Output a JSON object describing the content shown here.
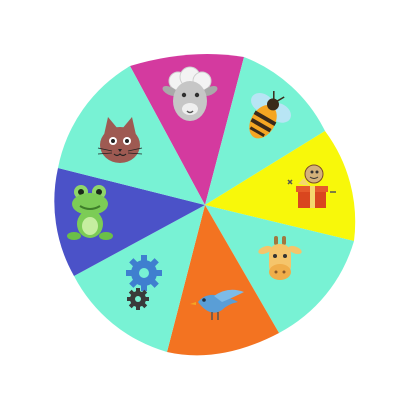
{
  "wheel": {
    "segments": [
      {
        "id": "sheep",
        "color": "#d43a9f",
        "icon": "sheep-icon"
      },
      {
        "id": "bee",
        "color": "#78f2d4",
        "icon": "bee-icon"
      },
      {
        "id": "gift",
        "color": "#f8f80a",
        "icon": "gift-icon"
      },
      {
        "id": "cow",
        "color": "#78f2d4",
        "icon": "cow-icon"
      },
      {
        "id": "bird",
        "color": "#f37321",
        "icon": "bird-icon"
      },
      {
        "id": "settings",
        "color": "#78f2d4",
        "icon": "gears-icon"
      },
      {
        "id": "frog",
        "color": "#4b52c8",
        "icon": "frog-icon"
      },
      {
        "id": "cat",
        "color": "#78f2d4",
        "icon": "cat-icon"
      }
    ]
  }
}
